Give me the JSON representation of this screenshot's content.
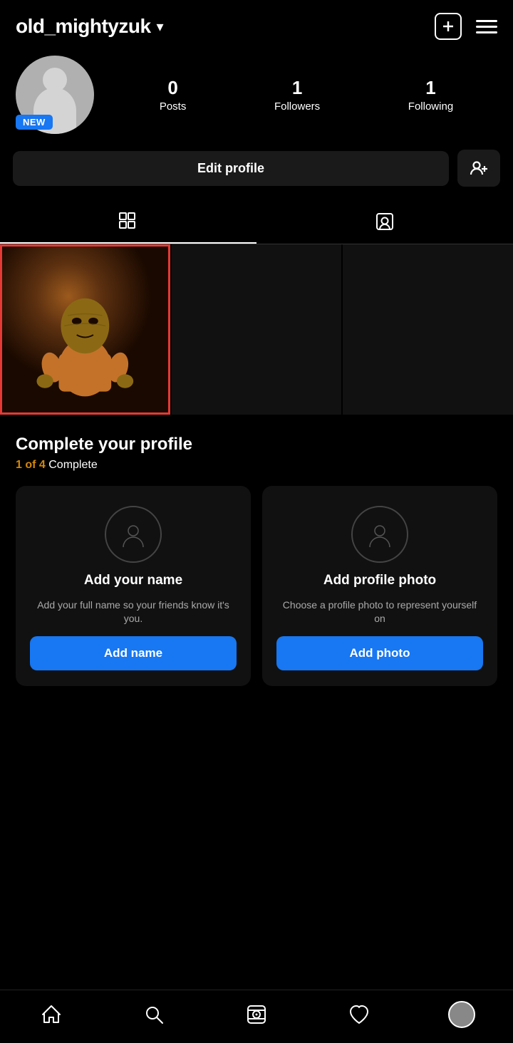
{
  "header": {
    "username": "old_mightyzuk",
    "chevron": "▾",
    "add_icon_label": "+",
    "menu_icon_label": "menu"
  },
  "profile": {
    "avatar_alt": "profile avatar",
    "new_badge": "NEW",
    "stats": [
      {
        "number": "0",
        "label": "Posts"
      },
      {
        "number": "1",
        "label": "Followers"
      },
      {
        "number": "1",
        "label": "Following"
      }
    ]
  },
  "buttons": {
    "edit_profile": "Edit profile",
    "add_friend": "+👤"
  },
  "tabs": [
    {
      "id": "grid",
      "label": "Grid view",
      "active": true
    },
    {
      "id": "tagged",
      "label": "Tagged posts",
      "active": false
    }
  ],
  "complete_profile": {
    "title": "Complete your profile",
    "progress_highlight": "1 of 4",
    "progress_rest": " Complete",
    "cards": [
      {
        "id": "add-name",
        "title": "Add your name",
        "desc": "Add your full name so your friends know it's you.",
        "btn_label": "Add name"
      },
      {
        "id": "add-photo",
        "title": "Add profile photo",
        "desc": "Choose a profile photo to represent yourself on",
        "btn_label": "Add photo"
      }
    ]
  },
  "bottom_nav": [
    {
      "id": "home",
      "label": "Home"
    },
    {
      "id": "search",
      "label": "Search"
    },
    {
      "id": "reels",
      "label": "Reels"
    },
    {
      "id": "heart",
      "label": "Activity"
    },
    {
      "id": "profile",
      "label": "Profile"
    }
  ]
}
